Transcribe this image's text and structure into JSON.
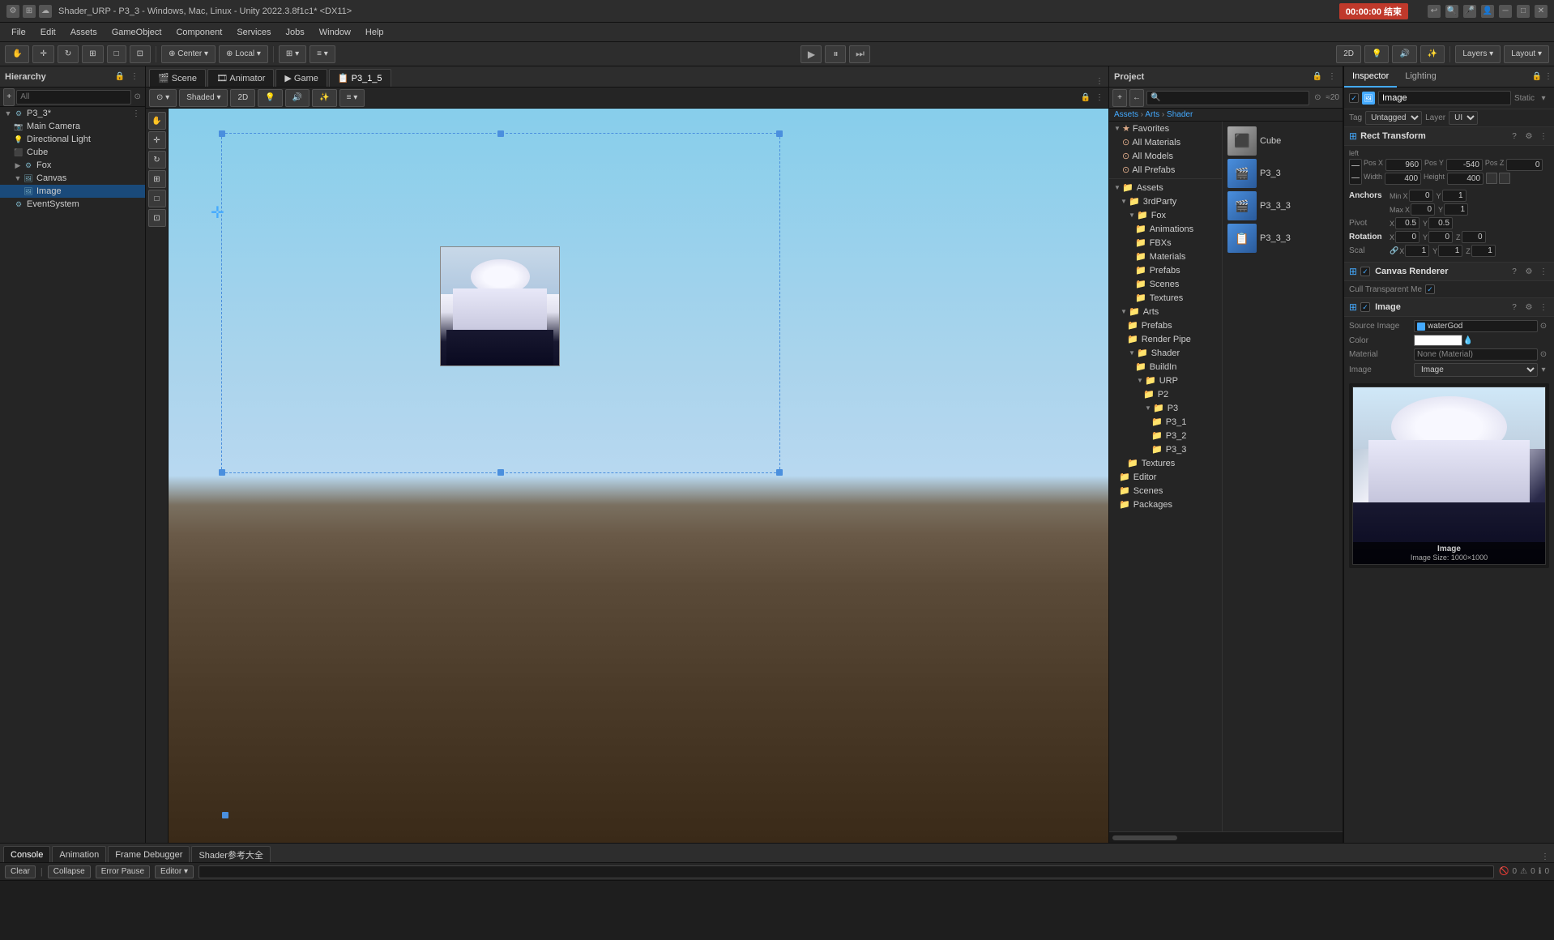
{
  "titleBar": {
    "title": "Shader_URP - P3_3 - Windows, Mac, Linux - Unity 2022.3.8f1c1* <DX11>",
    "timer": "00:00:00 结束"
  },
  "menuBar": {
    "items": [
      "File",
      "Edit",
      "Assets",
      "GameObject",
      "Component",
      "Services",
      "Jobs",
      "Window",
      "Help"
    ]
  },
  "hierarchy": {
    "title": "Hierarchy",
    "searchPlaceholder": "All",
    "items": [
      {
        "label": "P3_3*",
        "level": 0,
        "type": "root",
        "arrow": "▼"
      },
      {
        "label": "Main Camera",
        "level": 1,
        "type": "camera"
      },
      {
        "label": "Directional Light",
        "level": 1,
        "type": "light"
      },
      {
        "label": "Cube",
        "level": 1,
        "type": "cube"
      },
      {
        "label": "Fox",
        "level": 1,
        "type": "fox",
        "arrow": "▶"
      },
      {
        "label": "Canvas",
        "level": 1,
        "type": "canvas",
        "arrow": "▼"
      },
      {
        "label": "Image",
        "level": 2,
        "type": "image",
        "selected": true
      },
      {
        "label": "EventSystem",
        "level": 1,
        "type": "go"
      }
    ]
  },
  "sceneTabs": [
    {
      "label": "Scene",
      "icon": "🎬",
      "active": false
    },
    {
      "label": "Animator",
      "icon": "🎞",
      "active": false
    },
    {
      "label": "Game",
      "icon": "▶",
      "active": false
    },
    {
      "label": "P3_1_5",
      "icon": "📋",
      "active": true
    }
  ],
  "projectPanel": {
    "title": "Project",
    "breadcrumbs": [
      "Assets",
      "Arts",
      "Shader"
    ],
    "favorites": {
      "label": "Favorites",
      "items": [
        "All Materials",
        "All Models",
        "All Prefabs"
      ]
    },
    "assets": {
      "label": "Assets",
      "children": [
        {
          "label": "3rdParty",
          "children": [
            {
              "label": "Fox",
              "children": [
                {
                  "label": "Animations"
                },
                {
                  "label": "FBXs"
                },
                {
                  "label": "Materials"
                },
                {
                  "label": "Prefabs"
                },
                {
                  "label": "Scenes"
                },
                {
                  "label": "Textures"
                }
              ]
            }
          ]
        },
        {
          "label": "Arts",
          "children": [
            {
              "label": "Prefabs"
            },
            {
              "label": "Render Pipe"
            },
            {
              "label": "Shader",
              "children": [
                {
                  "label": "BuildIn"
                },
                {
                  "label": "URP",
                  "children": [
                    {
                      "label": "P2"
                    },
                    {
                      "label": "P3",
                      "children": [
                        {
                          "label": "P3_1"
                        },
                        {
                          "label": "P3_2"
                        },
                        {
                          "label": "P3_3"
                        }
                      ]
                    }
                  ]
                }
              ]
            },
            {
              "label": "Textures"
            }
          ]
        },
        {
          "label": "Editor"
        },
        {
          "label": "Scenes"
        },
        {
          "label": "Packages"
        }
      ]
    },
    "files": [
      {
        "label": "Cube",
        "icon": "cube"
      },
      {
        "label": "P3_3",
        "icon": "scene"
      },
      {
        "label": "P3_3_3",
        "icon": "scene"
      },
      {
        "label": "P3_3_3",
        "icon": "file"
      }
    ]
  },
  "inspector": {
    "tabs": [
      "Inspector",
      "Lighting"
    ],
    "activeTab": "Inspector",
    "componentName": "Image",
    "isStatic": "Static",
    "tag": "Untagged",
    "layer": "UI",
    "rectTransform": {
      "title": "Rect Transform",
      "left": "left",
      "posX": "960",
      "posY": "-540",
      "posZ": "0",
      "width": "400",
      "height": "400",
      "anchors": {
        "title": "Anchors",
        "minX": "0",
        "minY": "1",
        "maxX": "0",
        "maxY": "1"
      },
      "pivot": {
        "x": "0.5",
        "y": "0.5"
      },
      "rotation": {
        "title": "Rotation",
        "x": "0",
        "y": "0",
        "z": "0"
      },
      "scale": {
        "x": "1",
        "y": "1",
        "z": "1"
      }
    },
    "canvasRenderer": {
      "title": "Canvas Renderer",
      "cullTransparentMesh": true
    },
    "image": {
      "title": "Image",
      "sourceImage": "waterGod",
      "color": "#ffffff",
      "material": "None (Material)",
      "imageType": "Image",
      "imageSizeLabel": "Image",
      "imageSizeValue": "Image Size: 1000×1000"
    }
  },
  "console": {
    "tabs": [
      "Console",
      "Animation",
      "Frame Debugger",
      "Shader参考大全"
    ],
    "activeTab": "Console",
    "toolbar": {
      "clear": "Clear",
      "collapse": "Collapse",
      "errorPause": "Error Pause",
      "editor": "Editor"
    },
    "counts": {
      "errors": "0",
      "warnings": "0",
      "info": "0"
    }
  }
}
